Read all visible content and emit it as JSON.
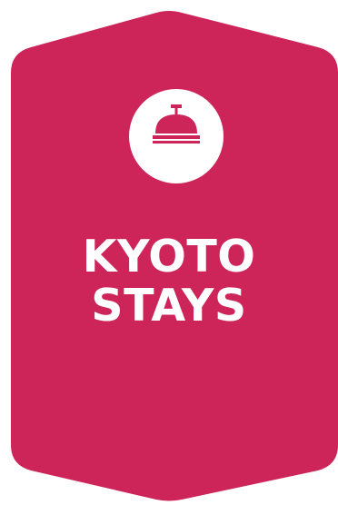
{
  "badge": {
    "color": "#cd255a",
    "icon": "service-bell-icon",
    "title_lines": [
      "KYOTO",
      "STAYS"
    ]
  }
}
